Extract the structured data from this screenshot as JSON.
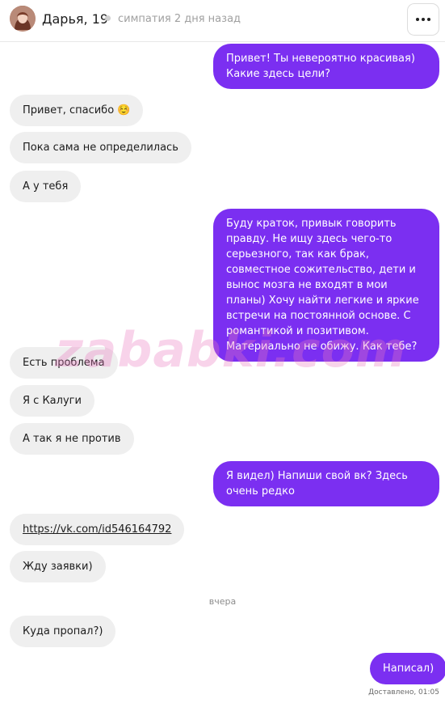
{
  "header": {
    "name": "Дарья, 19",
    "match": "симпатия 2 дня назад",
    "menu_icon": "more-horizontal-icon"
  },
  "messages": [
    {
      "side": "out",
      "text": "Привет! Ты невероятно красивая) Какие здесь цели?"
    },
    {
      "side": "in",
      "text": "Привет, спасибо ☺️"
    },
    {
      "side": "in",
      "text": "Пока сама не определилась"
    },
    {
      "side": "in",
      "text": "А у тебя"
    },
    {
      "side": "out",
      "text": "Буду краток, привык говорить правду. Не ищу здесь чего-то серьезного, так как брак, совместное сожительство, дети и вынос мозга не входят в мои планы) Хочу найти легкие и яркие встречи на постоянной основе. С романтикой и позитивом. Материально не обижу. Как тебе?"
    },
    {
      "side": "in",
      "text": "Есть проблема"
    },
    {
      "side": "in",
      "text": "Я с Калуги"
    },
    {
      "side": "in",
      "text": "А так я не против"
    },
    {
      "side": "out",
      "text": "Я видел) Напиши свой вк? Здесь очень редко"
    },
    {
      "side": "in",
      "text": "https://vk.com/id546164792"
    },
    {
      "side": "in",
      "text": "Жду заявки)"
    },
    {
      "side": "in",
      "text": "Куда пропал?)"
    },
    {
      "side": "out",
      "text": "Написал)"
    }
  ],
  "day_separator": "вчера",
  "status": "Доставлено, 01:05",
  "watermark": "zababki.com",
  "colors": {
    "outgoing": "#7b2ff1",
    "incoming": "#efefef"
  }
}
